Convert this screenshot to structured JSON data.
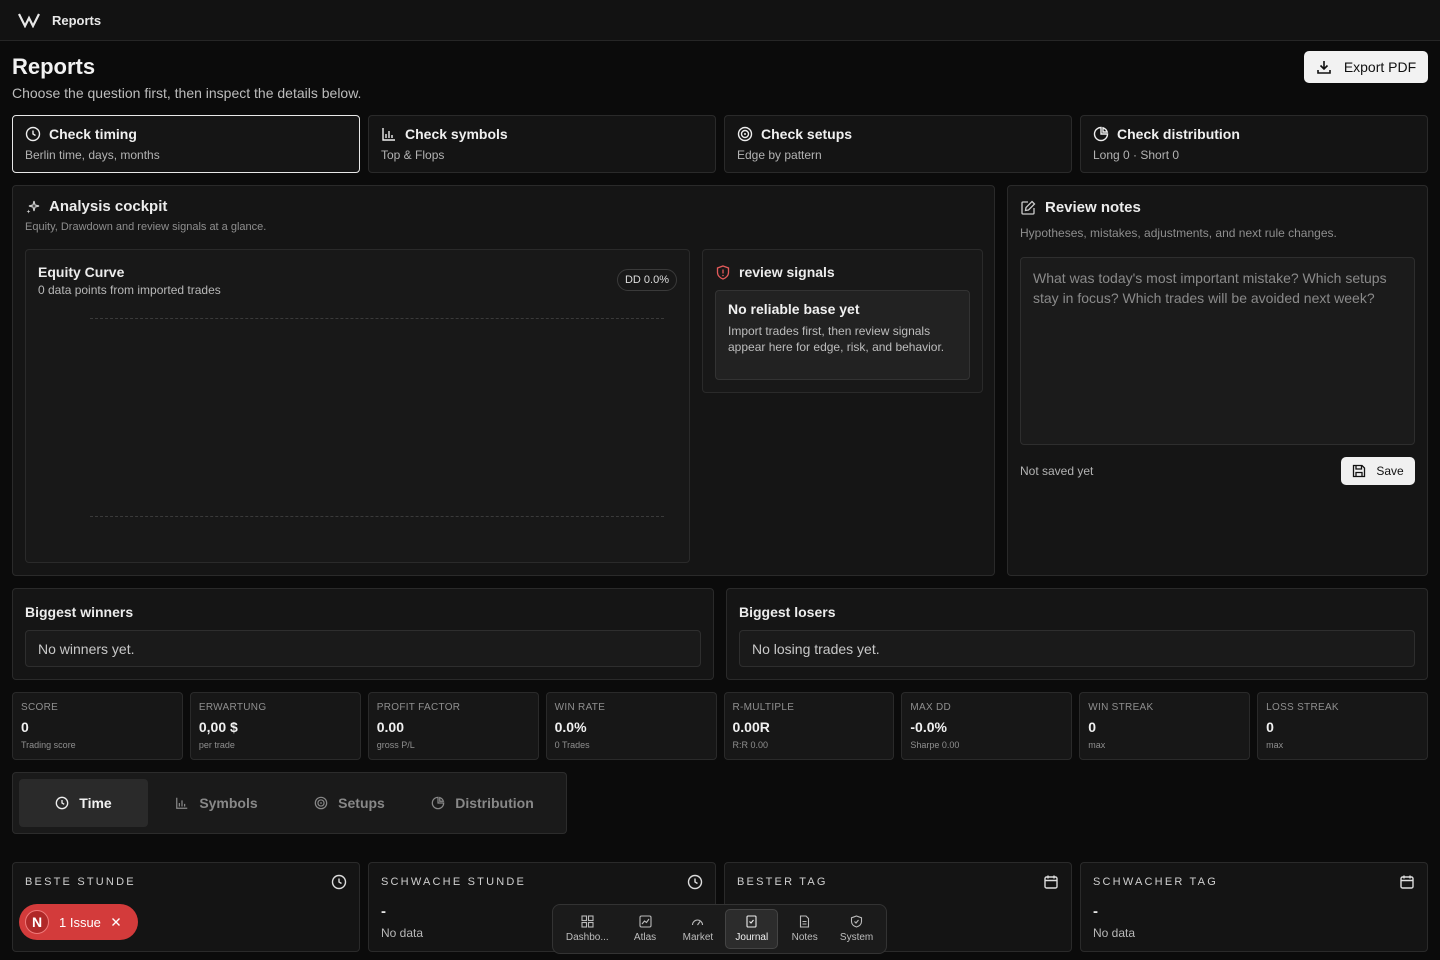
{
  "app": {
    "title": "Reports"
  },
  "header": {
    "title": "Reports",
    "subtitle": "Choose the question first, then inspect the details below.",
    "export_label": "Export PDF"
  },
  "questions": [
    {
      "title": "Check timing",
      "sub": "Berlin time, days, months",
      "icon": "clock-icon"
    },
    {
      "title": "Check symbols",
      "sub": "Top & Flops",
      "icon": "bar-chart-icon"
    },
    {
      "title": "Check setups",
      "sub": "Edge by pattern",
      "icon": "target-icon"
    },
    {
      "title": "Check distribution",
      "sub": "Long 0 · Short 0",
      "icon": "pie-icon"
    }
  ],
  "cockpit": {
    "title": "Analysis cockpit",
    "subtitle": "Equity, Drawdown and review signals at a glance.",
    "equity": {
      "title": "Equity Curve",
      "subtitle": "0 data points from imported trades",
      "dd_badge": "DD 0.0%"
    },
    "signals": {
      "title": "review signals",
      "box_title": "No reliable base yet",
      "box_text": "Import trades first, then review signals appear here for edge, risk, and behavior."
    }
  },
  "notes": {
    "title": "Review notes",
    "subtitle": "Hypotheses, mistakes, adjustments, and next rule changes.",
    "placeholder": "What was today's most important mistake? Which setups stay in focus? Which trades will be avoided next week?",
    "status": "Not saved yet",
    "save_label": "Save"
  },
  "winners": {
    "title": "Biggest winners",
    "empty": "No winners yet."
  },
  "losers": {
    "title": "Biggest losers",
    "empty": "No losing trades yet."
  },
  "kpis": [
    {
      "label": "SCORE",
      "value": "0",
      "sub": "Trading score"
    },
    {
      "label": "ERWARTUNG",
      "value": "0,00 $",
      "sub": "per trade"
    },
    {
      "label": "PROFIT FACTOR",
      "value": "0.00",
      "sub": "gross P/L"
    },
    {
      "label": "WIN RATE",
      "value": "0.0%",
      "sub": "0 Trades"
    },
    {
      "label": "R-MULTIPLE",
      "value": "0.00R",
      "sub": "R:R 0.00"
    },
    {
      "label": "MAX DD",
      "value": "-0.0%",
      "sub": "Sharpe 0.00"
    },
    {
      "label": "WIN STREAK",
      "value": "0",
      "sub": "max"
    },
    {
      "label": "LOSS STREAK",
      "value": "0",
      "sub": "max"
    }
  ],
  "tabs": [
    {
      "label": "Time",
      "icon": "clock-icon",
      "active": true
    },
    {
      "label": "Symbols",
      "icon": "bar-chart-icon",
      "active": false
    },
    {
      "label": "Setups",
      "icon": "target-icon",
      "active": false
    },
    {
      "label": "Distribution",
      "icon": "pie-icon",
      "active": false
    }
  ],
  "stats": [
    {
      "label": "BESTE STUNDE",
      "value": "",
      "sub": "",
      "icon": "clock-icon"
    },
    {
      "label": "SCHWACHE STUNDE",
      "value": "-",
      "sub": "No data",
      "icon": "clock-icon"
    },
    {
      "label": "BESTER TAG",
      "value": "",
      "sub": "",
      "icon": "calendar-icon"
    },
    {
      "label": "SCHWACHER TAG",
      "value": "-",
      "sub": "No data",
      "icon": "calendar-icon"
    }
  ],
  "issue": {
    "letter": "N",
    "label": "1 Issue"
  },
  "dock": [
    {
      "label": "Dashbo...",
      "icon": "grid-icon",
      "active": false
    },
    {
      "label": "Atlas",
      "icon": "chart-icon",
      "active": false
    },
    {
      "label": "Market",
      "icon": "gauge-icon",
      "active": false
    },
    {
      "label": "Journal",
      "icon": "journal-icon",
      "active": true
    },
    {
      "label": "Notes",
      "icon": "document-icon",
      "active": false
    },
    {
      "label": "System",
      "icon": "shield-icon",
      "active": false
    }
  ]
}
